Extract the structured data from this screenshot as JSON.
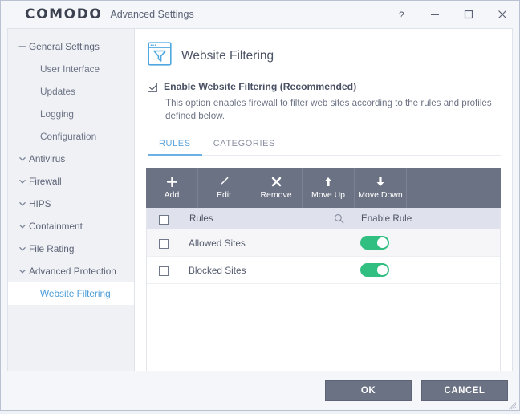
{
  "titlebar": {
    "brand": "COMODO",
    "app_title": "Advanced Settings",
    "help_label": "?",
    "minimize_label": "–",
    "maximize_label": "□",
    "close_label": "×"
  },
  "sidebar": {
    "items": [
      {
        "label": "General Settings",
        "level": 0,
        "state": "expanded",
        "icon": "minus-icon",
        "selected": false
      },
      {
        "label": "User Interface",
        "level": 1,
        "state": "leaf",
        "icon": "",
        "selected": false
      },
      {
        "label": "Updates",
        "level": 1,
        "state": "leaf",
        "icon": "",
        "selected": false
      },
      {
        "label": "Logging",
        "level": 1,
        "state": "leaf",
        "icon": "",
        "selected": false
      },
      {
        "label": "Configuration",
        "level": 1,
        "state": "leaf",
        "icon": "",
        "selected": false
      },
      {
        "label": "Antivirus",
        "level": 0,
        "state": "collapsed",
        "icon": "chevron-down-icon",
        "selected": false
      },
      {
        "label": "Firewall",
        "level": 0,
        "state": "collapsed",
        "icon": "chevron-down-icon",
        "selected": false
      },
      {
        "label": "HIPS",
        "level": 0,
        "state": "collapsed",
        "icon": "chevron-down-icon",
        "selected": false
      },
      {
        "label": "Containment",
        "level": 0,
        "state": "collapsed",
        "icon": "chevron-down-icon",
        "selected": false
      },
      {
        "label": "File Rating",
        "level": 0,
        "state": "collapsed",
        "icon": "chevron-down-icon",
        "selected": false
      },
      {
        "label": "Advanced Protection",
        "level": 0,
        "state": "collapsed",
        "icon": "chevron-down-icon",
        "selected": false
      },
      {
        "label": "Website Filtering",
        "level": 1,
        "state": "leaf",
        "icon": "",
        "selected": true
      }
    ]
  },
  "main": {
    "page_title": "Website Filtering",
    "page_icon": "website-filter-icon",
    "enable": {
      "label": "Enable Website Filtering (Recommended)",
      "checked": true,
      "description": "This option enables firewall to filter web sites according to the rules and profiles defined below."
    },
    "tabs": [
      {
        "label": "RULES",
        "active": true
      },
      {
        "label": "CATEGORIES",
        "active": false
      }
    ],
    "toolbar": [
      {
        "label": "Add",
        "icon": "plus-icon"
      },
      {
        "label": "Edit",
        "icon": "pencil-icon"
      },
      {
        "label": "Remove",
        "icon": "cross-icon"
      },
      {
        "label": "Move Up",
        "icon": "arrow-up-icon"
      },
      {
        "label": "Move Down",
        "icon": "arrow-down-icon"
      }
    ],
    "table": {
      "select_all_checked": false,
      "columns": [
        "Rules",
        "Enable Rule"
      ],
      "search_icon": "search-icon",
      "rows": [
        {
          "name": "Allowed Sites",
          "checked": false,
          "enabled": true
        },
        {
          "name": "Blocked Sites",
          "checked": false,
          "enabled": true
        }
      ]
    }
  },
  "footer": {
    "ok_label": "OK",
    "cancel_label": "CANCEL"
  },
  "colors": {
    "accent_blue": "#5ba4dd",
    "toolbar_slate": "#6b7284",
    "toggle_green": "#30bf81",
    "header_row": "#dfe2ec"
  }
}
